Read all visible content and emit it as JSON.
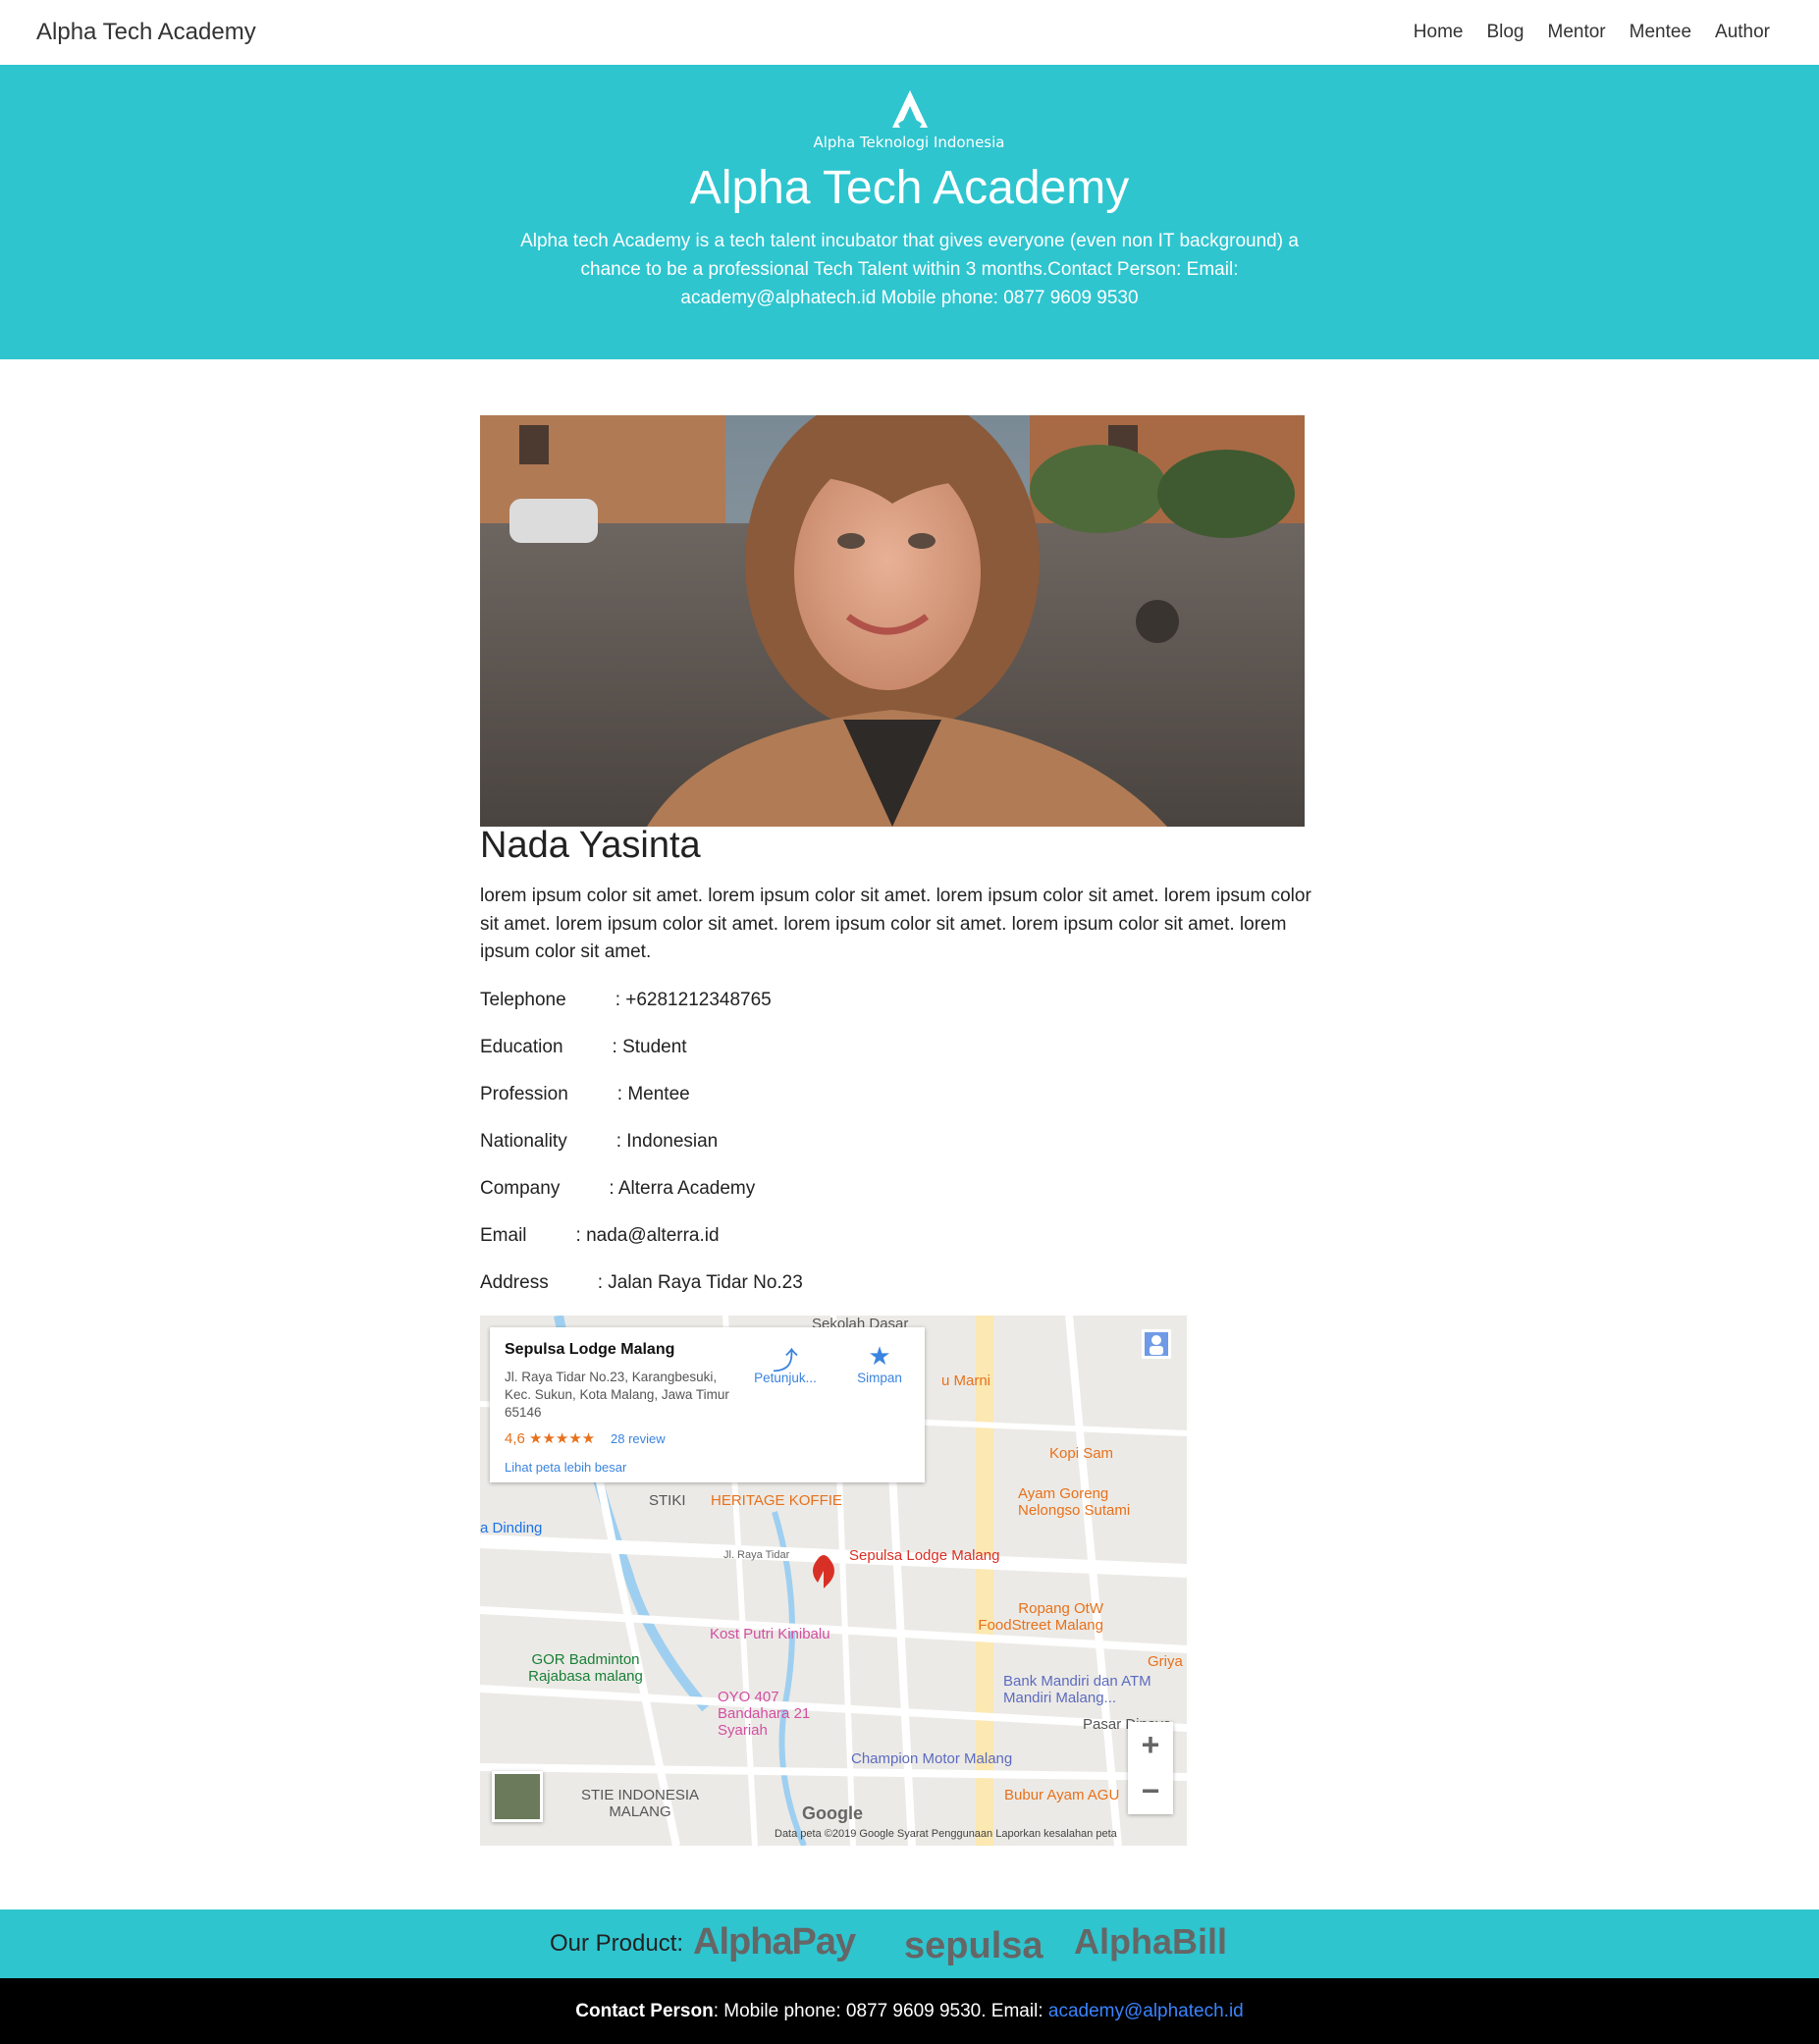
{
  "nav": {
    "brand": "Alpha Tech Academy",
    "links": [
      "Home",
      "Blog",
      "Mentor",
      "Mentee",
      "Author"
    ]
  },
  "hero": {
    "logo_text": "Alpha Teknologi Indonesia",
    "title": "Alpha Tech Academy",
    "description": "Alpha tech Academy is a tech talent incubator that gives everyone (even non IT background) a chance to be a professional Tech Talent within 3 months.Contact Person: Email: academy@alphatech.id Mobile phone: 0877 9609 9530"
  },
  "profile": {
    "name": "Nada Yasinta",
    "bio": "lorem ipsum color sit amet. lorem ipsum color sit amet. lorem ipsum color sit amet. lorem ipsum color sit amet. lorem ipsum color sit amet. lorem ipsum color sit amet. lorem ipsum color sit amet. lorem ipsum color sit amet.",
    "details": [
      {
        "label": "Telephone",
        "value": ": +6281212348765"
      },
      {
        "label": "Education",
        "value": ": Student"
      },
      {
        "label": "Profession",
        "value": ": Mentee"
      },
      {
        "label": "Nationality",
        "value": ": Indonesian"
      },
      {
        "label": "Company",
        "value": ": Alterra Academy"
      },
      {
        "label": "Email",
        "value": ": nada@alterra.id"
      },
      {
        "label": "Address",
        "value": ": Jalan Raya Tidar No.23"
      }
    ]
  },
  "map": {
    "place_name": "Sepulsa Lodge Malang",
    "address": "Jl. Raya Tidar No.23, Karangbesuki, Kec. Sukun, Kota Malang, Jawa Timur 65146",
    "rating": "4,6 ★★★★★",
    "reviews": "28 review",
    "bigger_map": "Lihat peta lebih besar",
    "directions": "Petunjuk...",
    "save": "Simpan",
    "labels": {
      "l1": "Sekolah Dasar",
      "l2": "u Marni",
      "l3": "Kopi Sam",
      "l4": "Ayam Goreng Nelongso Sutami",
      "l5": "STIKI",
      "l6": "HERITAGE KOFFIE",
      "l7": "a Dinding",
      "l8": "Sepulsa Lodge Malang",
      "l9": "Jl. Raya Tidar",
      "l10": "Kost Putri Kinibalu",
      "l11": "Ropang OtW FoodStreet Malang",
      "l12": "GOR Badminton Rajabasa malang",
      "l13": "OYO 407 Bandahara 21 Syariah",
      "l14": "Bank Mandiri dan ATM Mandiri Malang...",
      "l15": "Champion Motor Malang",
      "l16": "STIE INDONESIA MALANG",
      "l17": "Bubur Ayam AGU",
      "l18": "Griya",
      "l19": "Pasar Dinoyo"
    },
    "google": "Google",
    "footer": "Data peta ©2019 Google    Syarat Penggunaan    Laporkan kesalahan peta",
    "zoom_in": "+",
    "zoom_out": "−"
  },
  "footer": {
    "products_label": "Our Product:",
    "products": [
      "AlphaPay",
      "sepulsa",
      "AlphaBill"
    ],
    "contact_label": "Contact Person",
    "contact_text": ": Mobile phone: 0877 9609 9530. Email: ",
    "contact_email": "academy@alphatech.id"
  },
  "colors": {
    "brand": "#2ec5cf",
    "footer_bg": "#000000",
    "link": "#3a84ff"
  }
}
